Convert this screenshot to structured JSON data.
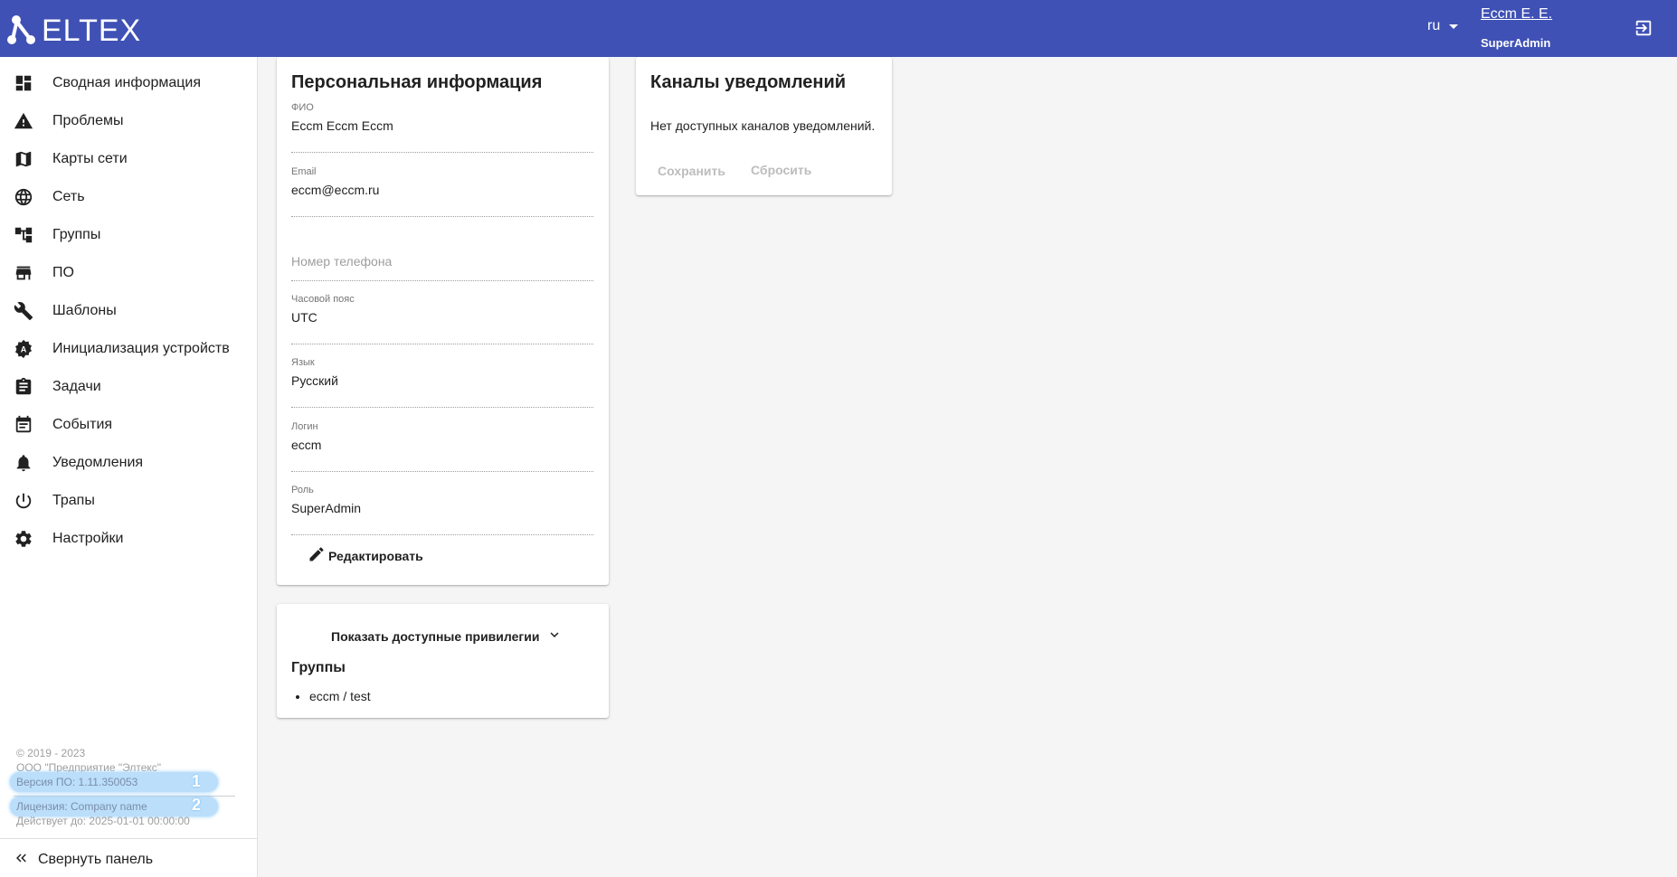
{
  "header": {
    "logo_text": "ELTEX",
    "language": "ru",
    "user_name": "Eccm E. E.",
    "user_role": "SuperAdmin",
    "logout_icon": "logout-icon"
  },
  "colors": {
    "primary": "#3f51b5",
    "highlight": "#bbdefb"
  },
  "sidebar": {
    "items": [
      {
        "label": "Сводная информация",
        "icon": "dashboard-icon"
      },
      {
        "label": "Проблемы",
        "icon": "warning-icon"
      },
      {
        "label": "Карты сети",
        "icon": "map-icon"
      },
      {
        "label": "Сеть",
        "icon": "globe-icon"
      },
      {
        "label": "Группы",
        "icon": "hierarchy-icon"
      },
      {
        "label": "ПО",
        "icon": "store-icon"
      },
      {
        "label": "Шаблоны",
        "icon": "wrench-icon"
      },
      {
        "label": "Инициализация устройств",
        "icon": "auto-setup-icon"
      },
      {
        "label": "Задачи",
        "icon": "clipboard-icon"
      },
      {
        "label": "События",
        "icon": "calendar-icon"
      },
      {
        "label": "Уведомления",
        "icon": "bell-icon"
      },
      {
        "label": "Трапы",
        "icon": "power-icon"
      },
      {
        "label": "Настройки",
        "icon": "gear-icon"
      }
    ],
    "footer": {
      "copyright": "© 2019 - 2023",
      "company": "ООО \"Предприятие \"Элтекс\"",
      "version": "Версия ПО: 1.11.350053",
      "license": "Лицензия: Company name",
      "valid_until": "Действует до: 2025-01-01 00:00:00",
      "marker_1": "1",
      "marker_2": "2"
    },
    "collapse_label": "Свернуть панель"
  },
  "personal": {
    "title": "Персональная информация",
    "fields": [
      {
        "label": "ФИО",
        "value": "Eccm Eccm Eccm"
      },
      {
        "label": "Email",
        "value": "eccm@eccm.ru"
      },
      {
        "label": "",
        "value": "",
        "placeholder": "Номер телефона"
      },
      {
        "label": "Часовой пояс",
        "value": "UTC"
      },
      {
        "label": "Язык",
        "value": "Русский"
      },
      {
        "label": "Логин",
        "value": "eccm"
      },
      {
        "label": "Роль",
        "value": "SuperAdmin"
      }
    ],
    "edit_label": "Редактировать"
  },
  "privileges": {
    "toggle_label": "Показать доступные привилегии",
    "groups_title": "Группы",
    "groups": [
      "eccm / test"
    ]
  },
  "notifications": {
    "title": "Каналы уведомлений",
    "empty_text": "Нет доступных каналов уведомлений.",
    "save_label": "Сохранить",
    "reset_label": "Сбросить"
  }
}
